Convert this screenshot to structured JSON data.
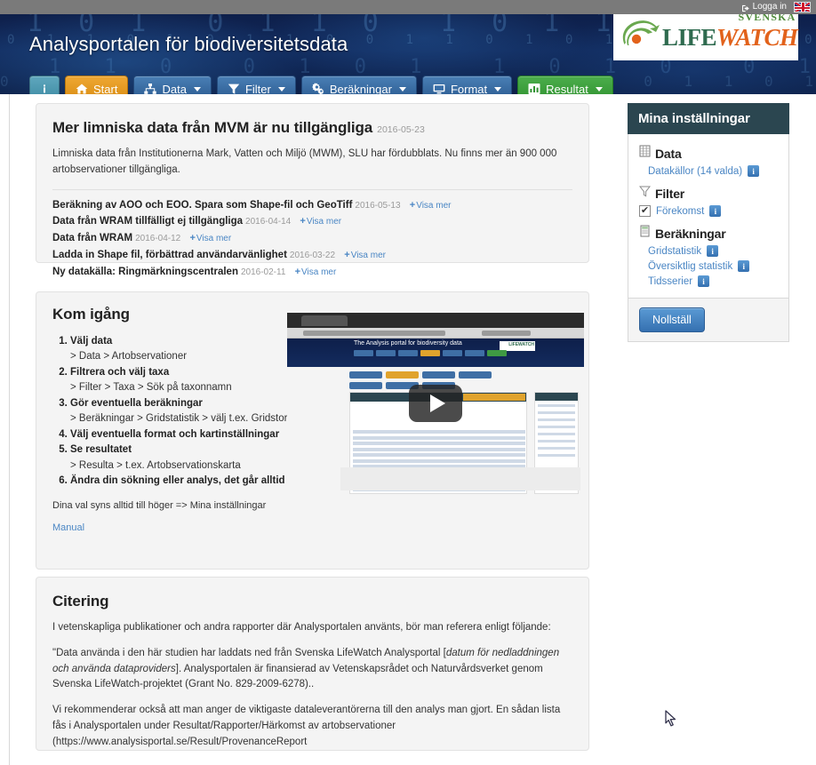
{
  "topbar": {
    "login_label": "Logga in",
    "login_icon": "sign-in-icon",
    "flag_icon": "uk-flag-icon"
  },
  "header": {
    "title": "Analysportalen för biodiversitetsdata",
    "binary_rows": [
      "1 0 1  0 1 1 0  1 0 1 1  0 1 0  1 1 0 1  0 1 1 0  1 0 1",
      "0 1 1 0 1 0 1 1 0 0 1 1 0 1 0 1 1 0 1 0 0 1 1 0 1 0 1 1 0 1",
      "1 1 0  0 1 0 1  1 0 1 0  0 1 1  0 1 0 1  1 0 0 1  0 1 1",
      "0 1 0 1 1 0 0 1 0 1 1 0 1 0 1 0 0 1 1 0 1 0 1 1 0 0 1 0 1 1"
    ],
    "logo": {
      "svenska": "SVENSKA",
      "life": "LIFE",
      "watch": "WATCH",
      "mark_icon": "lifewatch-leaf-icon"
    }
  },
  "nav": {
    "items": [
      {
        "label": "",
        "icon": "info-icon",
        "style": "info",
        "caret": false
      },
      {
        "label": "Start",
        "icon": "home-icon",
        "style": "start",
        "caret": false
      },
      {
        "label": "Data",
        "icon": "sitemap-icon",
        "style": "blue",
        "caret": true
      },
      {
        "label": "Filter",
        "icon": "funnel-icon",
        "style": "blue",
        "caret": true
      },
      {
        "label": "Beräkningar",
        "icon": "gears-icon",
        "style": "blue",
        "caret": true
      },
      {
        "label": "Format",
        "icon": "monitor-icon",
        "style": "blue",
        "caret": true
      },
      {
        "label": "Resultat",
        "icon": "chart-bar-icon",
        "style": "green",
        "caret": true
      }
    ]
  },
  "news": {
    "title": "Mer limniska data från MVM är nu tillgängliga",
    "date": "2016-05-23",
    "lead": "Limniska data från Institutionerna Mark, Vatten och Miljö (MWM), SLU har fördubblats. Nu finns mer än 900 000 artobservationer tillgängliga.",
    "show_more_label": "Visa mer",
    "items": [
      {
        "title": "Beräkning av AOO och EOO. Spara som Shape-fil och GeoTiff",
        "date": "2016-05-13"
      },
      {
        "title": "Data från WRAM tillfälligt ej tillgängliga",
        "date": "2016-04-14"
      },
      {
        "title": "Data från WRAM",
        "date": "2016-04-12"
      },
      {
        "title": "Ladda in Shape fil, förbättrad användarvänlighet",
        "date": "2016-03-22"
      },
      {
        "title": "Ny datakälla: Ringmärkningscentralen",
        "date": "2016-02-11"
      }
    ]
  },
  "getting_started": {
    "title": "Kom igång",
    "steps": [
      {
        "main": "Välj data",
        "sub": "> Data > Artobservationer"
      },
      {
        "main": "Filtrera och välj taxa",
        "sub": "> Filter > Taxa > Sök på taxonnamn"
      },
      {
        "main": "Gör eventuella beräkningar",
        "sub": "> Beräkningar > Gridstatistik > välj t.ex. Gridstorlek"
      },
      {
        "main": "Välj eventuella format och kartinställningar",
        "sub": ""
      },
      {
        "main": "Se resultatet",
        "sub": "> Resulta > t.ex. Artobservationskarta"
      },
      {
        "main": "Ändra din sökning eller analys, det går alltid att gå direkt till resultatknappen!",
        "sub": ""
      }
    ],
    "note": "Dina val syns alltid till höger => Mina inställningar",
    "manual_label": "Manual",
    "video": {
      "play_icon": "play-button-icon",
      "screenshot_title": "The Analysis portal for biodiversity data"
    }
  },
  "citation": {
    "title": "Citering",
    "paragraph1": "I vetenskapliga publikationer och andra rapporter där Analysportalen använts, bör man referera enligt följande:",
    "paragraph2_a": "\"Data använda i den här studien har laddats ned från Svenska LifeWatch Analysportal [",
    "paragraph2_i": "datum för nedladdningen och använda dataproviders",
    "paragraph2_b": "]. Analysportalen är finansierad av Vetenskapsrådet och Naturvårdsverket genom Svenska LifeWatch-projektet (Grant No. 829-2009-6278)..",
    "paragraph3": "Vi rekommenderar också att man anger de viktigaste dataleverantörerna till den analys man gjort. En sådan lista fås i Analysportalen under Resultat/Rapporter/Härkomst av artobservationer (https://www.analysisportal.se/Result/ProvenanceReport"
  },
  "sidebar": {
    "title": "Mina inställningar",
    "sections": [
      {
        "label": "Data",
        "icon": "database-grid-icon",
        "links": [
          {
            "label": "Datakällor (14 valda)",
            "badge": "i",
            "checkbox": false
          }
        ]
      },
      {
        "label": "Filter",
        "icon": "funnel-icon",
        "links": [
          {
            "label": "Förekomst",
            "badge": "i",
            "checkbox": true,
            "checked": "✔"
          }
        ]
      },
      {
        "label": "Beräkningar",
        "icon": "calculator-icon",
        "links": [
          {
            "label": "Gridstatistik",
            "badge": "i",
            "checkbox": false
          },
          {
            "label": "Översiktlig statistik",
            "badge": "i",
            "checkbox": false
          },
          {
            "label": "Tidsserier",
            "badge": "i",
            "checkbox": false
          }
        ]
      }
    ],
    "reset_label": "Nollställ"
  },
  "colors": {
    "sidebar_header": "#2b4650",
    "link": "#4a86c4",
    "accent_orange": "#d88c12",
    "accent_green": "#2f9130",
    "banner_navy": "#0e1f4a"
  }
}
